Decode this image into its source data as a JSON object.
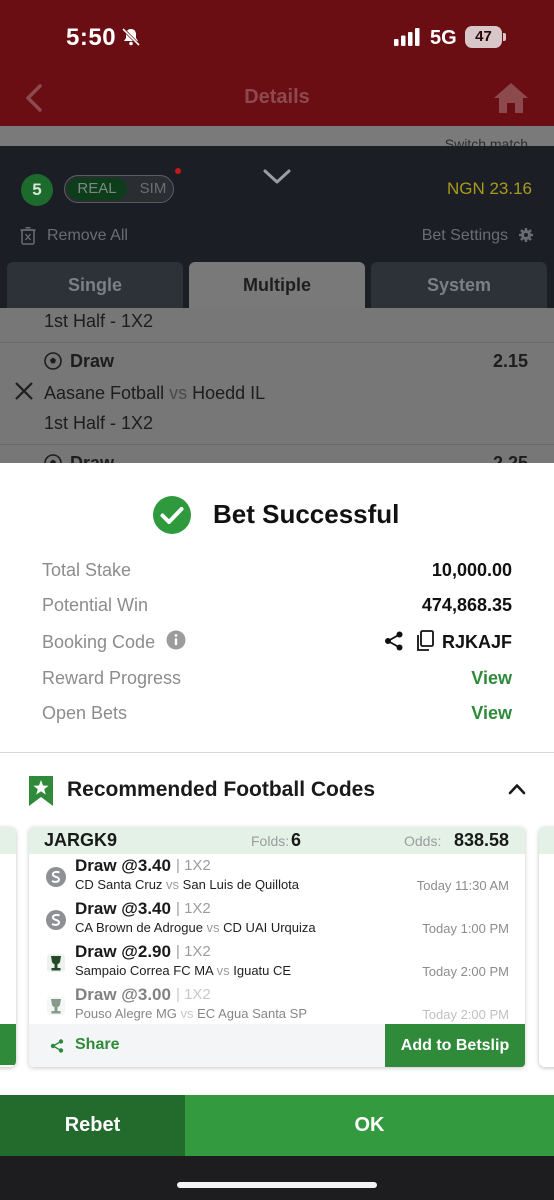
{
  "status_bar": {
    "time": "5:50",
    "network": "5G",
    "battery": "47"
  },
  "header": {
    "title": "Details"
  },
  "match_strip": {
    "switch_label": "Switch match"
  },
  "betslip": {
    "count": "5",
    "mode_real": "REAL",
    "mode_sim": "SIM",
    "balance": "NGN 23.16",
    "remove_all": "Remove All",
    "bet_settings": "Bet Settings",
    "tabs": [
      "Single",
      "Multiple",
      "System"
    ],
    "selections": [
      {
        "market": "1st Half - 1X2"
      },
      {
        "pick": "Draw",
        "odds": "2.15",
        "home": "Aasane Fotball",
        "vs": "vs",
        "away": "Hoedd IL",
        "market": "1st Half - 1X2"
      },
      {
        "pick": "Draw",
        "odds": "2.25"
      }
    ]
  },
  "result": {
    "title": "Bet Successful",
    "rows": {
      "total_stake": {
        "label": "Total Stake",
        "value": "10,000.00"
      },
      "potential_win": {
        "label": "Potential Win",
        "value": "474,868.35"
      },
      "booking_code": {
        "label": "Booking Code",
        "value": "RJKAJF"
      },
      "reward_progress": {
        "label": "Reward Progress",
        "link": "View"
      },
      "open_bets": {
        "label": "Open Bets",
        "link": "View"
      }
    }
  },
  "recommended": {
    "title": "Recommended Football Codes",
    "card": {
      "code": "JARGK9",
      "folds_label": "Folds:",
      "folds": "6",
      "odds_label": "Odds:",
      "odds": "838.58",
      "picks": [
        {
          "selection": "Draw @3.40",
          "market": "| 1X2",
          "home": "CD Santa Cruz",
          "vs": "vs",
          "away": "San Luis de Quillota",
          "time": "Today 11:30 AM",
          "icon": "soccer-league-icon"
        },
        {
          "selection": "Draw @3.40",
          "market": "| 1X2",
          "home": "CA Brown de Adrogue",
          "vs": "vs",
          "away": "CD UAI Urquiza",
          "time": "Today 1:00 PM",
          "icon": "soccer-league-icon"
        },
        {
          "selection": "Draw @2.90",
          "market": "| 1X2",
          "home": "Sampaio Correa FC MA",
          "vs": "vs",
          "away": "Iguatu CE",
          "time": "Today 2:00 PM",
          "icon": "trophy-league-icon"
        },
        {
          "selection": "Draw @3.00",
          "market": "| 1X2",
          "home": "Pouso Alegre MG",
          "vs": "vs",
          "away": "EC Agua Santa SP",
          "time": "Today 2:00 PM",
          "icon": "trophy-league-icon"
        }
      ],
      "share": "Share",
      "add_to_betslip": "Add to Betslip"
    }
  },
  "actions": {
    "rebet": "Rebet",
    "ok": "OK"
  },
  "colors": {
    "brand_red": "#6a0e14",
    "accent_green": "#2f8a3a",
    "ok_green": "#339a3f",
    "rebet_green": "#226b2c"
  }
}
